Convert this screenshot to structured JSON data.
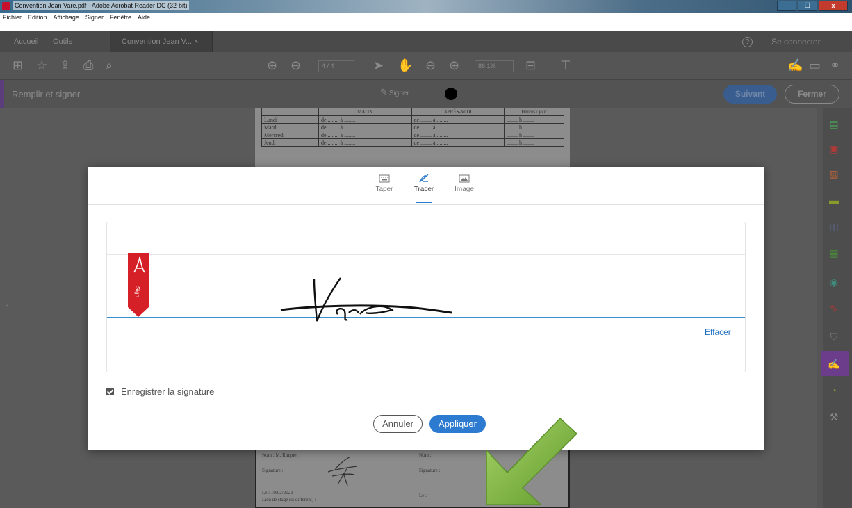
{
  "window": {
    "title": "Convention Jean Vare.pdf - Adobe Acrobat Reader DC (32-bit)",
    "controls": {
      "minimize": "—",
      "maximize": "❐",
      "close": "x"
    }
  },
  "menu": [
    "Fichier",
    "Edition",
    "Affichage",
    "Signer",
    "Fenêtre",
    "Aide"
  ],
  "tabs": {
    "home": "Accueil",
    "tools": "Outils",
    "document": "Convention Jean V... ×",
    "help": "?",
    "login": "Se connecter"
  },
  "toolbar": {
    "page_indicator": "4 / 4",
    "zoom": "86,1%",
    "icons": [
      "new-doc-icon",
      "star-icon",
      "share-icon",
      "print-icon",
      "search-icon",
      "page-up-icon",
      "page-down-icon",
      "select-icon",
      "hand-icon",
      "zoom-out-icon",
      "zoom-in-icon",
      "fit-page-icon",
      "form-icon",
      "sign-icon",
      "comment-icon",
      "contact-icon"
    ]
  },
  "fill_sign": {
    "title": "Remplir et signer",
    "sign_label": "Signer",
    "color": "#000000",
    "next": "Suivant",
    "close": "Fermer"
  },
  "document": {
    "table_header": [
      "",
      "MATIN",
      "APRÈS-MIDI",
      "Heures / jour"
    ],
    "rows": [
      [
        "Lundi",
        "de ........ à ........",
        "de ........ à ........",
        "........ h ........"
      ],
      [
        "Mardi",
        "de ........ à ........",
        "de ........ à ........",
        "........ h ........"
      ],
      [
        "Mercredi",
        "de ........ à ........",
        "de ........ à ........",
        "........ h ........"
      ],
      [
        "Jeudi",
        "de ........ à ........",
        "de ........ à ........",
        "........ h ........"
      ]
    ],
    "bottom_left": [
      "Nom : M. Ringuet",
      "Signature :",
      "Le : 10/02/2021",
      "Lieu de stage (si différent) :"
    ],
    "bottom_right": [
      "Nom :",
      "Signature :",
      "Le :"
    ]
  },
  "modal": {
    "tabs": [
      {
        "label": "Taper",
        "icon": "keyboard-icon"
      },
      {
        "label": "Tracer",
        "icon": "draw-signature-icon"
      },
      {
        "label": "Image",
        "icon": "image-icon"
      }
    ],
    "active_tab": "Tracer",
    "bookmark_text": "Sign",
    "signature_text": "Vare",
    "erase": "Effacer",
    "save_label": "Enregistrer la signature",
    "save_checked": true,
    "cancel": "Annuler",
    "apply": "Appliquer"
  },
  "right_panel": {
    "tool_icons": [
      "export-pdf-icon",
      "create-pdf-icon",
      "edit-pdf-icon",
      "comment-icon",
      "combine-icon",
      "organize-icon",
      "send-icon",
      "fill-sign-icon",
      "protect-icon",
      "sign-active-icon",
      "stamp-icon",
      "more-tools-icon"
    ]
  },
  "colors": {
    "accent": "#2d7bd0",
    "annotation_arrow": "#7fb23a"
  }
}
